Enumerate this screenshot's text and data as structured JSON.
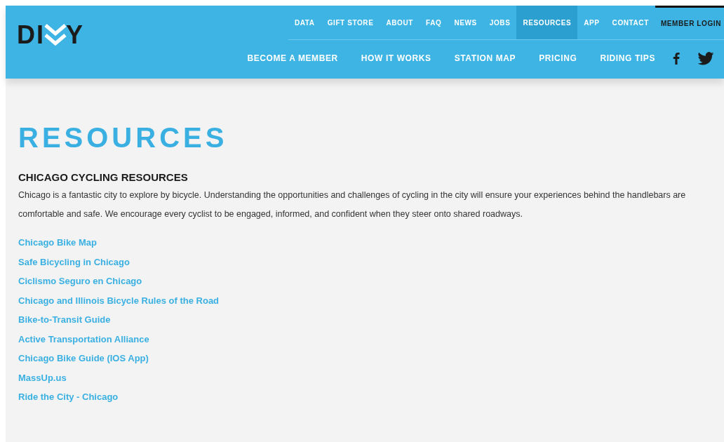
{
  "logo": {
    "left": "DI",
    "right": "Y"
  },
  "top_nav": [
    {
      "label": "DATA",
      "selected": false,
      "kind": "link"
    },
    {
      "label": "GIFT STORE",
      "selected": false,
      "kind": "link"
    },
    {
      "label": "ABOUT",
      "selected": false,
      "kind": "link"
    },
    {
      "label": "FAQ",
      "selected": false,
      "kind": "link"
    },
    {
      "label": "NEWS",
      "selected": false,
      "kind": "link"
    },
    {
      "label": "JOBS",
      "selected": false,
      "kind": "link"
    },
    {
      "label": "RESOURCES",
      "selected": true,
      "kind": "link"
    },
    {
      "label": "APP",
      "selected": false,
      "kind": "link"
    },
    {
      "label": "CONTACT",
      "selected": false,
      "kind": "link"
    },
    {
      "label": "MEMBER LOGIN",
      "selected": false,
      "kind": "login"
    }
  ],
  "main_nav": [
    {
      "label": "BECOME A MEMBER"
    },
    {
      "label": "HOW IT WORKS"
    },
    {
      "label": "STATION MAP"
    },
    {
      "label": "PRICING"
    },
    {
      "label": "RIDING TIPS"
    }
  ],
  "social": [
    {
      "kind": "facebook"
    },
    {
      "kind": "twitter"
    }
  ],
  "page_title": "RESOURCES",
  "section": {
    "heading": "CHICAGO CYCLING RESOURCES",
    "text": "Chicago is a fantastic city to explore by bicycle. Understanding the opportunities and challenges of cycling in the city will ensure your experiences behind the handlebars are comfortable and safe. We encourage every cyclist to be engaged, informed, and confident when they steer onto shared roadways."
  },
  "links": [
    "Chicago Bike Map",
    "Safe Bicycling in Chicago",
    "Ciclismo Seguro en Chicago",
    "Chicago and Illinois Bicycle Rules of the Road",
    "Bike-to-Transit Guide",
    "Active Transportation Alliance",
    "Chicago Bike Guide (IOS App)",
    "MassUp.us",
    "Ride the City - Chicago"
  ]
}
